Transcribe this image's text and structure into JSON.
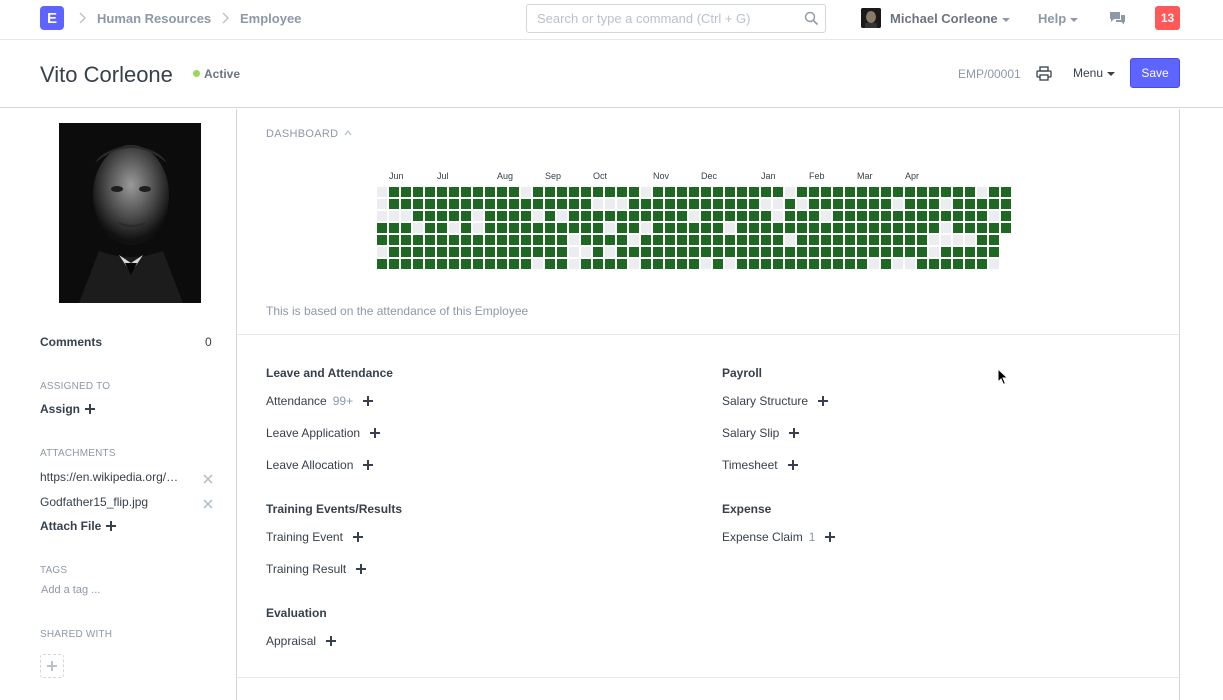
{
  "navbar": {
    "logo_letter": "E",
    "breadcrumbs": [
      "Human Resources",
      "Employee"
    ],
    "search_placeholder": "Search or type a command (Ctrl + G)",
    "user_name": "Michael Corleone",
    "help_label": "Help",
    "notification_count": "13"
  },
  "page": {
    "title": "Vito Corleone",
    "status": "Active",
    "doc_name": "EMP/00001",
    "menu_label": "Menu",
    "save_label": "Save"
  },
  "sidebar": {
    "comments_label": "Comments",
    "comments_count": "0",
    "assigned_to_label": "ASSIGNED TO",
    "assign_label": "Assign",
    "attachments_label": "ATTACHMENTS",
    "attachments": [
      "https://en.wikipedia.org/wiki/Vito_Corleone",
      "Godfather15_flip.jpg"
    ],
    "attach_file_label": "Attach File",
    "tags_label": "TAGS",
    "add_tag_placeholder": "Add a tag ...",
    "shared_with_label": "SHARED WITH"
  },
  "dashboard": {
    "heading": "DASHBOARD",
    "note": "This is based on the attendance of this Employee",
    "heatmap": {
      "months": [
        "Jun",
        "Jul",
        "Aug",
        "Sep",
        "Oct",
        "Nov",
        "Dec",
        "Jan",
        "Feb",
        "Mar",
        "Apr"
      ],
      "present_color": "#1e6823",
      "empty_color": "#ebedf0"
    }
  },
  "connections": {
    "groups": [
      {
        "title": "Leave and Attendance",
        "links": [
          {
            "label": "Attendance",
            "count": "99+"
          },
          {
            "label": "Leave Application",
            "count": ""
          },
          {
            "label": "Leave Allocation",
            "count": ""
          }
        ]
      },
      {
        "title": "Payroll",
        "links": [
          {
            "label": "Salary Structure",
            "count": ""
          },
          {
            "label": "Salary Slip",
            "count": ""
          },
          {
            "label": "Timesheet",
            "count": ""
          }
        ]
      },
      {
        "title": "Training Events/Results",
        "links": [
          {
            "label": "Training Event",
            "count": ""
          },
          {
            "label": "Training Result",
            "count": ""
          }
        ]
      },
      {
        "title": "Expense",
        "links": [
          {
            "label": "Expense Claim",
            "count": "1"
          }
        ]
      },
      {
        "title": "Evaluation",
        "links": [
          {
            "label": "Appraisal",
            "count": ""
          }
        ]
      }
    ]
  },
  "colors": {
    "accent": "#5e64ff",
    "notification": "#ff5858",
    "status_dot": "#98d85b"
  }
}
